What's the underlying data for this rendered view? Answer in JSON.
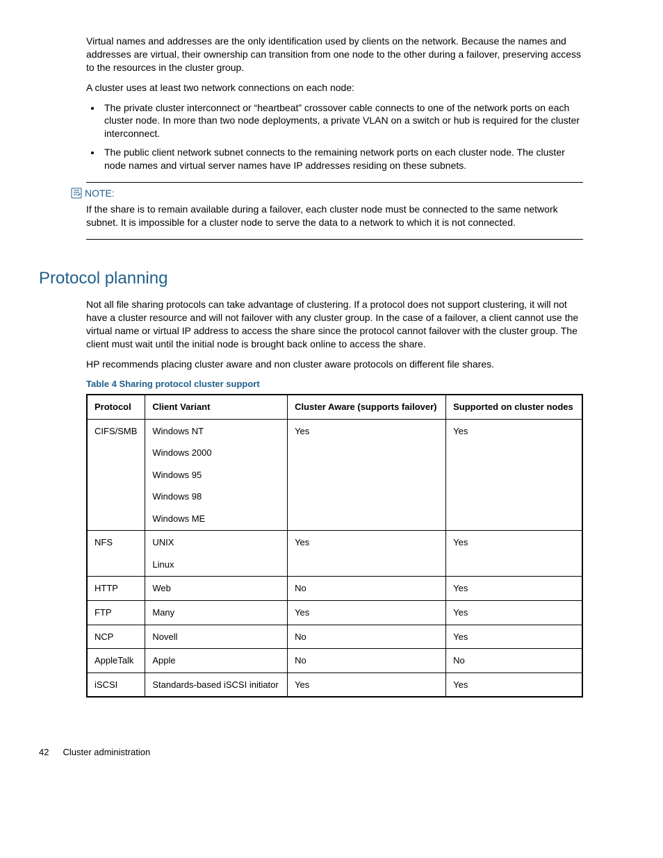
{
  "intro": {
    "p1": "Virtual names and addresses are the only identification used by clients on the network. Because the names and addresses are virtual, their ownership can transition from one node to the other during a failover, preserving access to the resources in the cluster group.",
    "p2": "A cluster uses at least two network connections on each node:",
    "bullets": [
      "The private cluster interconnect or “heartbeat” crossover cable connects to one of the network ports on each cluster node. In more than two node deployments, a private VLAN on a switch or hub is required for the cluster interconnect.",
      "The public client network subnet connects to the remaining network ports on each cluster node. The cluster node names and virtual server names have IP addresses residing on these subnets."
    ]
  },
  "note": {
    "label": "NOTE:",
    "body": "If the share is to remain available during a failover, each cluster node must be connected to the same network subnet. It is impossible for a cluster node to serve the data to a network to which it is not connected."
  },
  "section": {
    "heading": "Protocol planning",
    "p1": "Not all file sharing protocols can take advantage of clustering. If a protocol does not support clustering, it will not have a cluster resource and will not failover with any cluster group. In the case of a failover, a client cannot use the virtual name or virtual IP address to access the share since the protocol cannot failover with the cluster group. The client must wait until the initial node is brought back online to access the share.",
    "p2": "HP recommends placing cluster aware and non cluster aware protocols on different file shares."
  },
  "table": {
    "caption": "Table 4 Sharing protocol cluster support",
    "headers": [
      "Protocol",
      "Client Variant",
      "Cluster Aware (supports failover)",
      "Supported on cluster nodes"
    ],
    "rows": [
      {
        "protocol": "CIFS/SMB",
        "variants": [
          "Windows NT",
          "Windows 2000",
          "Windows 95",
          "Windows 98",
          "Windows ME"
        ],
        "aware": "Yes",
        "supported": "Yes"
      },
      {
        "protocol": "NFS",
        "variants": [
          "UNIX",
          "Linux"
        ],
        "aware": "Yes",
        "supported": "Yes"
      },
      {
        "protocol": "HTTP",
        "variants": [
          "Web"
        ],
        "aware": "No",
        "supported": "Yes"
      },
      {
        "protocol": "FTP",
        "variants": [
          "Many"
        ],
        "aware": "Yes",
        "supported": "Yes"
      },
      {
        "protocol": "NCP",
        "variants": [
          "Novell"
        ],
        "aware": "No",
        "supported": "Yes"
      },
      {
        "protocol": "AppleTalk",
        "variants": [
          "Apple"
        ],
        "aware": "No",
        "supported": "No"
      },
      {
        "protocol": "iSCSI",
        "variants": [
          "Standards-based iSCSI initiator"
        ],
        "aware": "Yes",
        "supported": "Yes"
      }
    ]
  },
  "footer": {
    "page": "42",
    "title": "Cluster administration"
  }
}
